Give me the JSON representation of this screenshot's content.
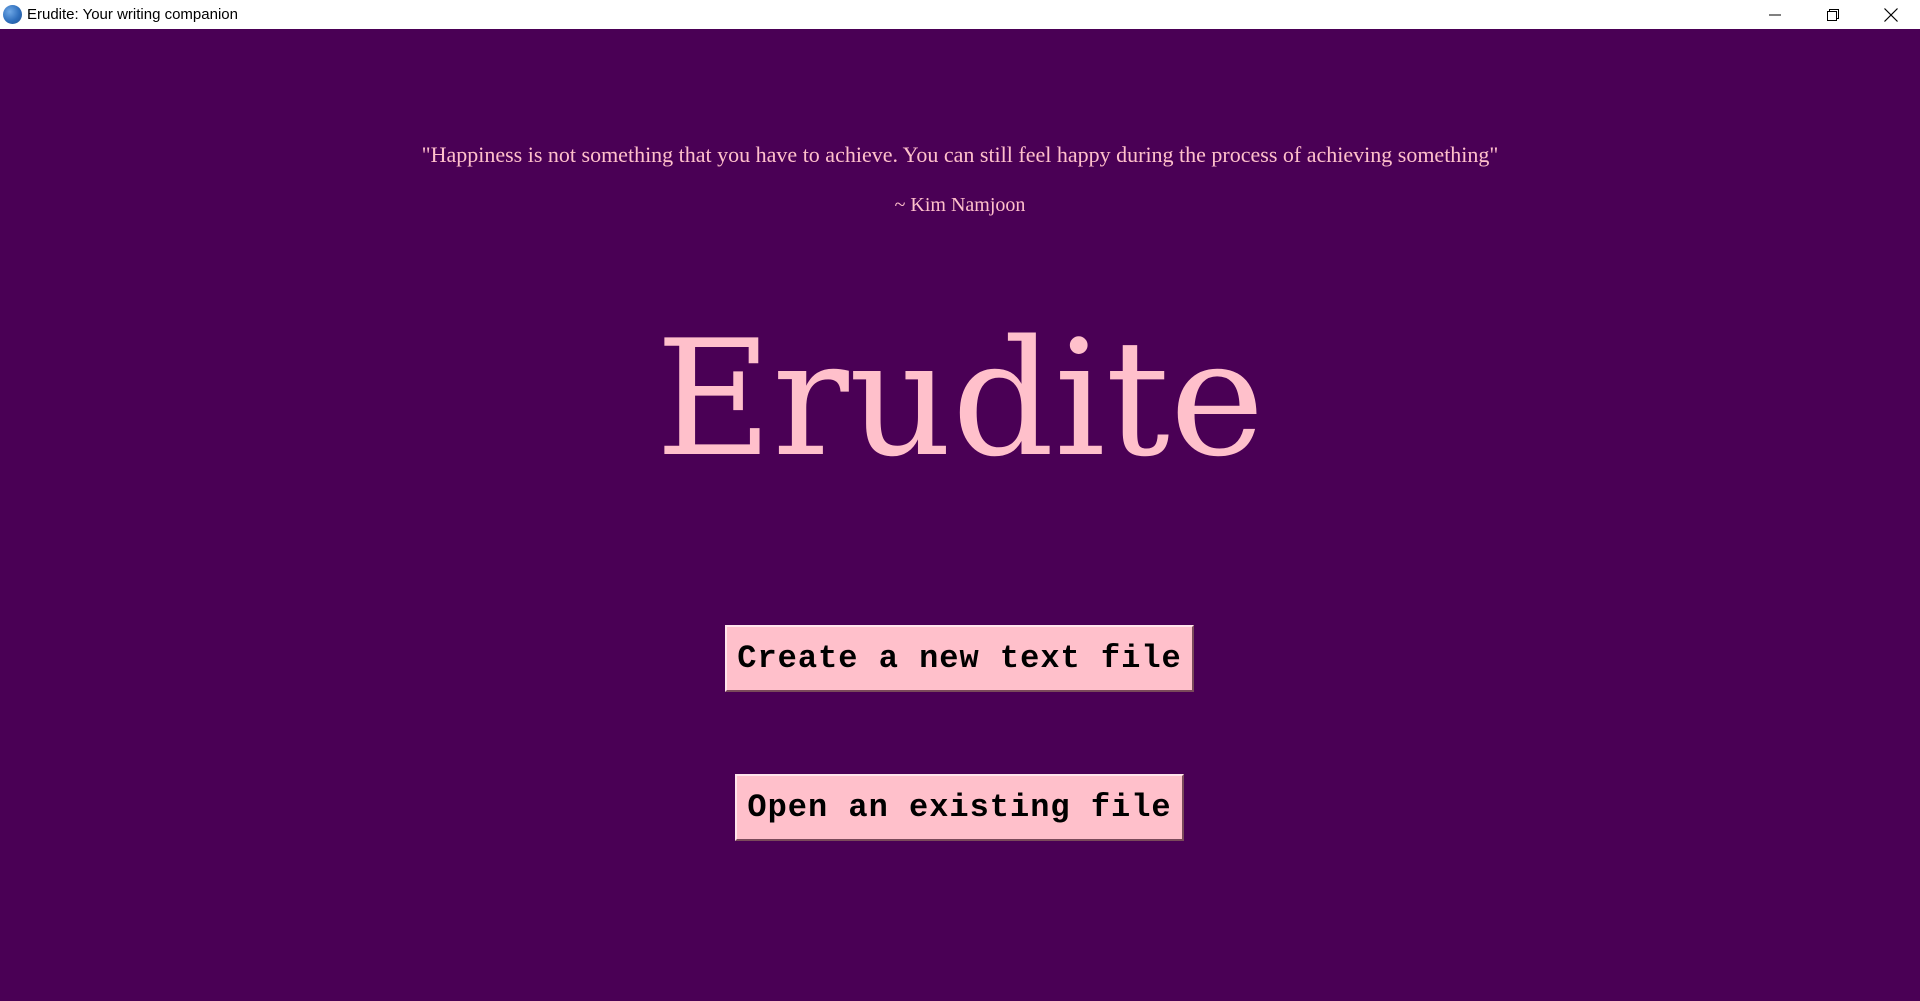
{
  "window": {
    "title": "Erudite: Your writing companion",
    "app_icon": "globe-icon",
    "controls": {
      "minimize_icon": "minimize-icon",
      "restore_icon": "restore-icon",
      "close_icon": "close-icon"
    }
  },
  "main": {
    "quote": "\"Happiness is not something that you have to achieve. You can still feel happy during the process of achieving something\"",
    "author": "~ Kim Namjoon",
    "app_name": "Erudite",
    "buttons": {
      "new_file": "Create a new text file",
      "open_file": "Open an existing file"
    }
  },
  "colors": {
    "background": "#4a0055",
    "accent_text": "#ffc0cb",
    "button_bg": "#ffc0cb",
    "button_text": "#000000"
  }
}
